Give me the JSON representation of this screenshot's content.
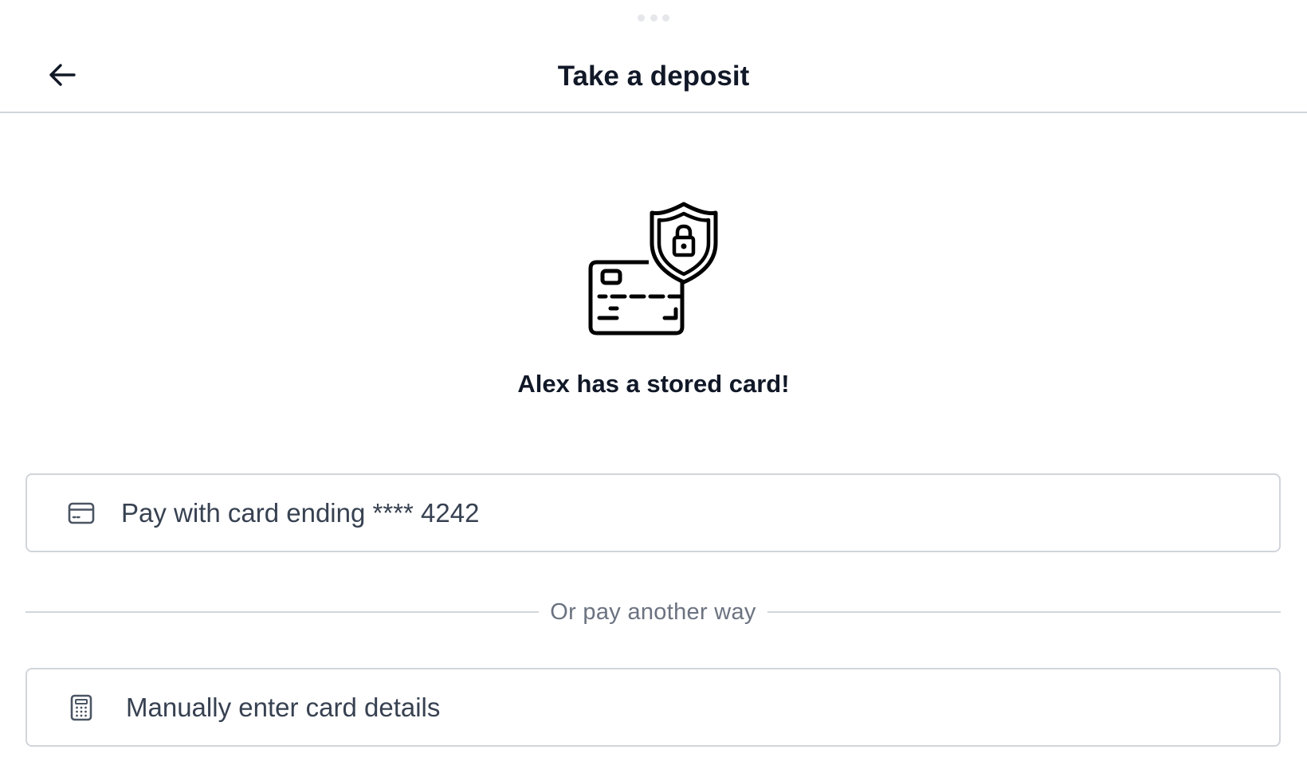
{
  "header": {
    "title": "Take a deposit",
    "back_icon": "arrow-left-icon"
  },
  "hero": {
    "icon": "card-shield-lock-icon",
    "message": "Alex has a stored card!"
  },
  "options": {
    "stored_card": {
      "icon": "credit-card-icon",
      "label": "Pay with card ending **** 4242"
    },
    "divider_text": "Or pay another way",
    "manual": {
      "icon": "calculator-icon",
      "label": "Manually enter card details"
    }
  },
  "colors": {
    "text_primary": "#111827",
    "text_secondary": "#374151",
    "text_muted": "#6b7280",
    "border": "#d1d5db"
  }
}
